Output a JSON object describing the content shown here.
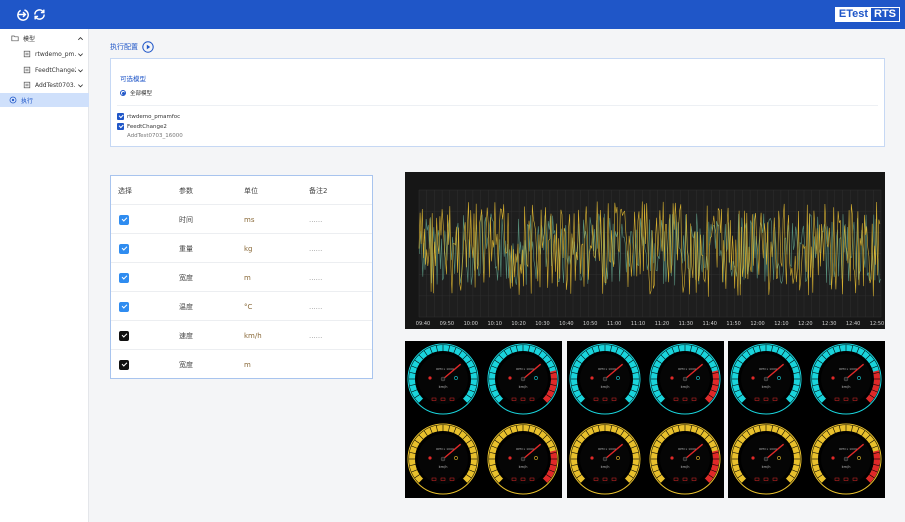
{
  "topbar": {
    "icons": [
      "exit-icon",
      "refresh-icon"
    ],
    "logo_part1": "ETest",
    "logo_part2": "RTS",
    "color": "#1f56c8"
  },
  "sidebar": {
    "items": [
      {
        "label": "模型",
        "icon": "folder-icon",
        "expanded": true
      },
      {
        "label": "rtwdemo_pm...",
        "icon": "model-icon"
      },
      {
        "label": "FeedtChange2",
        "icon": "model-icon"
      },
      {
        "label": "AddTest0703...",
        "icon": "model-icon"
      },
      {
        "label": "执行",
        "icon": "execute-icon",
        "active": true
      }
    ]
  },
  "config": {
    "title": "执行配置",
    "subtitle": "可选模型",
    "radio_label": "全部模型",
    "models": [
      {
        "label": "rtwdemo_pmamfoc",
        "checked": true
      },
      {
        "label": "FeedtChange2",
        "checked": true
      },
      {
        "label": "AddTest0703_16000",
        "checked": false
      }
    ]
  },
  "param_table": {
    "headers": [
      "选择",
      "参数",
      "单位",
      "备注2"
    ],
    "rows": [
      {
        "checkbox": "blue",
        "param": "时间",
        "unit": "ms",
        "note": "......"
      },
      {
        "checkbox": "blue",
        "param": "重量",
        "unit": "kg",
        "note": "......"
      },
      {
        "checkbox": "blue",
        "param": "宽度",
        "unit": "m",
        "note": "......"
      },
      {
        "checkbox": "blue",
        "param": "温度",
        "unit": "°C",
        "note": "......"
      },
      {
        "checkbox": "black",
        "param": "速度",
        "unit": "km/h",
        "note": "......"
      },
      {
        "checkbox": "black",
        "param": "宽度",
        "unit": "m",
        "note": ""
      }
    ]
  },
  "wave_chart": {
    "x_ticks": [
      "09:40",
      "09:50",
      "10:00",
      "10:10",
      "10:20",
      "10:30",
      "10:40",
      "10:50",
      "11:00",
      "11:10",
      "11:20",
      "11:30",
      "11:40",
      "11:50",
      "12:00",
      "12:10",
      "12:20",
      "12:30",
      "12:40",
      "12:50"
    ],
    "series_colors": [
      "#e0b832",
      "#5e9c86"
    ]
  },
  "gauges": {
    "panels": 3,
    "unit_label": "km/h",
    "rpm_label": "RPM x 1000",
    "colors": {
      "cyan": "#19d4dc",
      "yellow": "#e8c02c",
      "red": "#e02828",
      "needle": "#e02828"
    }
  }
}
